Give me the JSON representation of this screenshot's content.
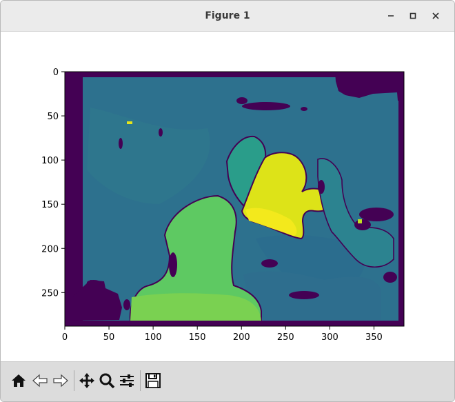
{
  "window": {
    "title": "Figure 1"
  },
  "controls": {
    "minimize_icon": "minimize-icon",
    "maximize_icon": "maximize-icon",
    "close_icon": "close-icon"
  },
  "chart_data": {
    "type": "heatmap",
    "title": "",
    "xlabel": "",
    "ylabel": "",
    "colormap": "viridis",
    "x_ticks": [
      0,
      50,
      100,
      150,
      200,
      250,
      300,
      350
    ],
    "y_ticks": [
      0,
      50,
      100,
      150,
      200,
      250
    ],
    "xlim": [
      0,
      384
    ],
    "ylim": [
      288,
      0
    ],
    "grid": false,
    "legend": "none"
  },
  "toolbar": {
    "buttons": [
      {
        "name": "home-button",
        "icon": "home-icon"
      },
      {
        "name": "back-button",
        "icon": "back-arrow-icon"
      },
      {
        "name": "forward-button",
        "icon": "forward-arrow-icon"
      },
      {
        "name": "pan-button",
        "icon": "move-icon"
      },
      {
        "name": "zoom-button",
        "icon": "zoom-icon"
      },
      {
        "name": "configure-subplots-button",
        "icon": "sliders-icon"
      },
      {
        "name": "save-button",
        "icon": "save-icon"
      }
    ]
  },
  "colors": {
    "dark_purple": "#440154",
    "deep_teal": "#2c6e8f",
    "teal": "#26828e",
    "green": "#3db87c",
    "light_green": "#74cf5c",
    "yellow": "#d8e219",
    "bright_yellow": "#f1e51d"
  }
}
